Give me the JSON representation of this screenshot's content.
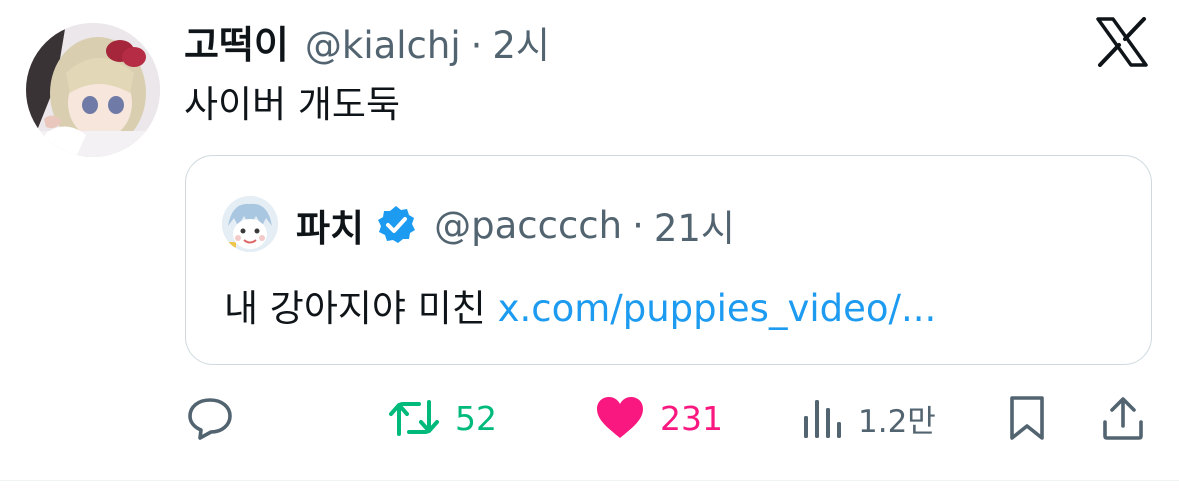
{
  "tweet": {
    "author_name": "고떡이",
    "author_handle": "@kialchj",
    "separator": "·",
    "time": "2시",
    "text": "사이버 개도둑"
  },
  "quoted": {
    "author_name": "파치",
    "verified": true,
    "author_handle": "@pacccch",
    "separator": "·",
    "time": "21시",
    "text": "내 강아지야 미친",
    "link": "x.com/puppies_video/..."
  },
  "actions": {
    "retweets": "52",
    "likes": "231",
    "views": "1.2만"
  },
  "icons": [
    "x-logo-icon",
    "verified-badge-icon",
    "reply-icon",
    "retweet-icon",
    "heart-icon",
    "views-icon",
    "bookmark-icon",
    "share-icon"
  ],
  "colors": {
    "text": "#0f1419",
    "secondary": "#536471",
    "link": "#1d9bf0",
    "retweet": "#00ba7c",
    "like": "#f91880",
    "border": "#cfd9de"
  }
}
